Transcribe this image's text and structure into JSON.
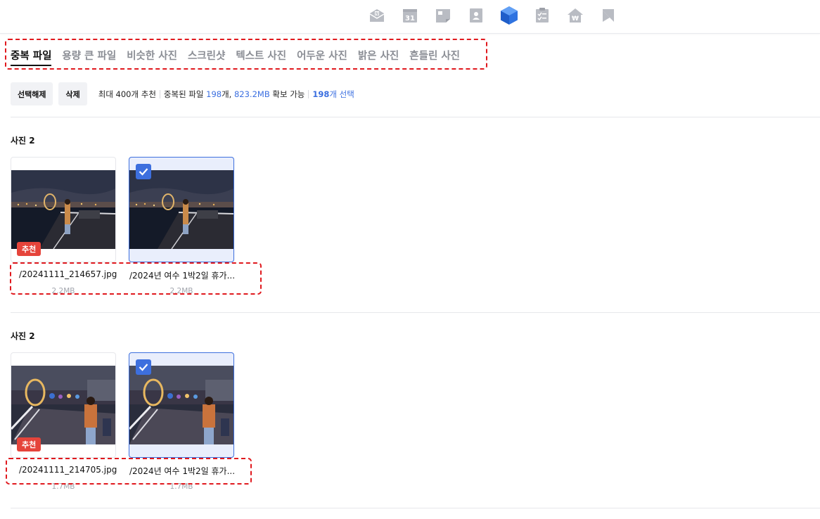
{
  "topbar": {
    "apps": [
      {
        "name": "mail",
        "active": false
      },
      {
        "name": "calendar",
        "label": "31",
        "active": false
      },
      {
        "name": "memo",
        "active": false
      },
      {
        "name": "contacts",
        "active": false
      },
      {
        "name": "mybox",
        "active": true
      },
      {
        "name": "todo",
        "active": false
      },
      {
        "name": "household-ledger",
        "label": "₩",
        "active": false
      },
      {
        "name": "bookmark",
        "active": false
      }
    ]
  },
  "tabs": [
    {
      "label": "중복 파일",
      "active": true
    },
    {
      "label": "용량 큰 파일",
      "active": false
    },
    {
      "label": "비슷한 사진",
      "active": false
    },
    {
      "label": "스크린샷",
      "active": false
    },
    {
      "label": "텍스트 사진",
      "active": false
    },
    {
      "label": "어두운 사진",
      "active": false
    },
    {
      "label": "밝은 사진",
      "active": false
    },
    {
      "label": "흔들린 사진",
      "active": false
    }
  ],
  "toolbar": {
    "deselect_label": "선택해제",
    "delete_label": "삭제",
    "max_recommend": "최대 400개 추천",
    "dup_prefix": "중복된 파일 ",
    "dup_count": "198",
    "dup_unit": "개, ",
    "dup_size": "823.2MB",
    "dup_suffix": " 확보 가능",
    "selected_count": "198",
    "selected_suffix": "개 선택"
  },
  "groups": [
    {
      "title": "사진 2",
      "files": [
        {
          "name": "/20241111_214657.jpg",
          "size": "2.2MB",
          "badge": "추천",
          "selected": false
        },
        {
          "name": "/2024년 여수 1박2일 휴가...",
          "size": "2.2MB",
          "selected": true
        }
      ]
    },
    {
      "title": "사진 2",
      "files": [
        {
          "name": "/20241111_214705.jpg",
          "size": "1.7MB",
          "badge": "추천",
          "selected": false
        },
        {
          "name": "/2024년 여수 1박2일 휴가...",
          "size": "1.7MB",
          "selected": true
        }
      ]
    }
  ],
  "colors": {
    "accent": "#3d6fde",
    "badge": "#e5443b",
    "highlight_box": "#e0191e"
  }
}
